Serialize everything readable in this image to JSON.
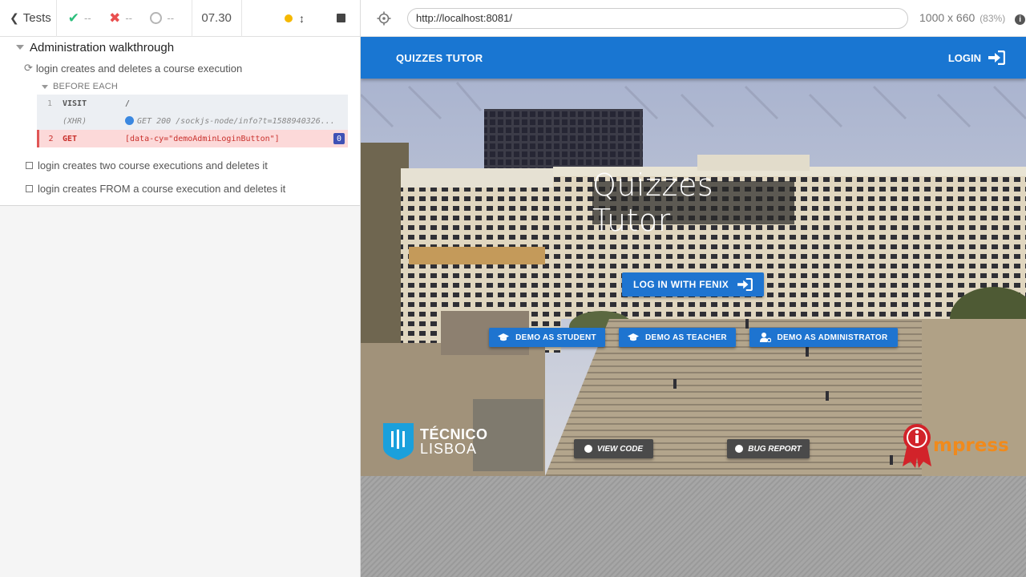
{
  "reporter": {
    "header": {
      "tests_label": "Tests",
      "passed": "--",
      "failed": "--",
      "pending": "--",
      "duration": "07.30"
    },
    "suite": {
      "title": "Administration walkthrough",
      "running_test": {
        "title": "login creates and deletes a course execution",
        "hook_label": "BEFORE EACH",
        "commands": [
          {
            "number": "1",
            "name": "VISIT",
            "message": "/"
          },
          {
            "number": "",
            "name": "(XHR)",
            "message": "GET 200 /sockjs-node/info?t=1588940326..."
          },
          {
            "number": "2",
            "name": "GET",
            "message": "[data-cy=\"demoAdminLoginButton\"]",
            "badge": "0",
            "state": "failed"
          }
        ]
      },
      "pending_tests": [
        "login creates two course executions and deletes it",
        "login creates FROM a course execution and deletes it"
      ]
    }
  },
  "aut": {
    "url": "http://localhost:8081/",
    "viewport": "1000 x 660",
    "scale": "(83%)",
    "info_icon": "i"
  },
  "app": {
    "brand": "QUIZZES TUTOR",
    "login_label": "LOGIN",
    "title": "Quizzes Tutor",
    "fenix_button": "LOG IN WITH FENIX",
    "demo_student": "DEMO AS STUDENT",
    "demo_teacher": "DEMO AS TEACHER",
    "demo_admin": "DEMO AS ADMINISTRATOR",
    "view_code": "VIEW CODE",
    "bug_report": "BUG REPORT",
    "logo_line1": "TÉCNICO",
    "logo_line2": "LISBOA",
    "impress_text": "mpress"
  },
  "colors": {
    "brand_blue": "#1976d2",
    "button_blue": "#1e74d0",
    "error_red": "#c9302c",
    "pass_green": "#2bbf7c"
  }
}
